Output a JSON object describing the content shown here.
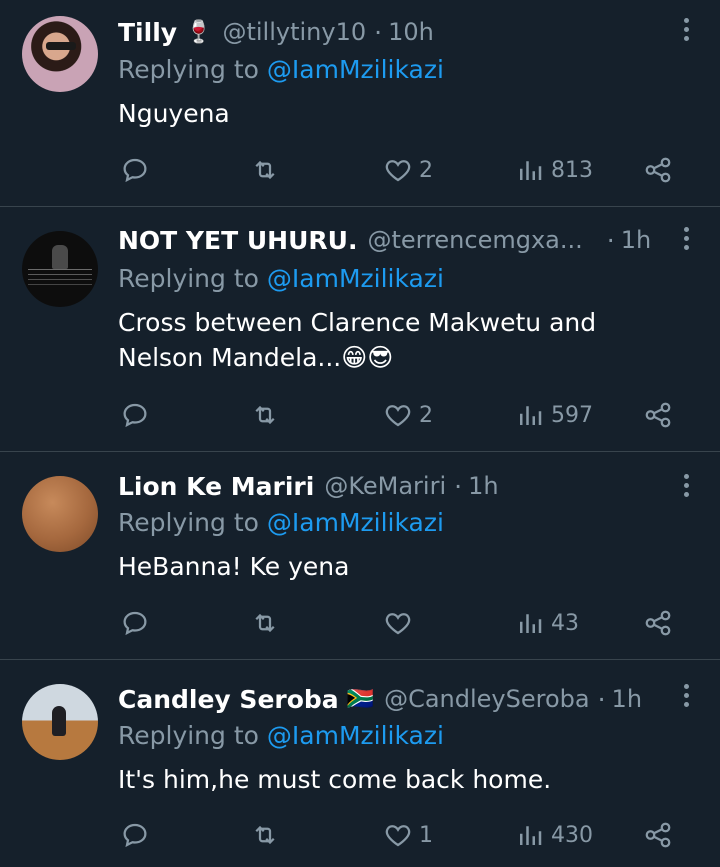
{
  "tweets": [
    {
      "name": "Tilly",
      "name_emoji": "🍷",
      "handle": "@tillytiny10",
      "separator": "·",
      "time": "10h",
      "replying_prefix": "Replying to",
      "replying_to": "@IamMzilikazi",
      "text": "Nguyena",
      "likes": "2",
      "views": "813"
    },
    {
      "name": "NOT YET UHURU.",
      "handle": "@terrencemgxa...",
      "separator": "·",
      "time": "1h",
      "replying_prefix": "Replying to",
      "replying_to": "@IamMzilikazi",
      "text": "Cross between Clarence Makwetu and Nelson Mandela...😁😎",
      "likes": "2",
      "views": "597"
    },
    {
      "name": "Lion Ke Mariri",
      "handle": "@KeMariri",
      "separator": "·",
      "time": "1h",
      "replying_prefix": "Replying to",
      "replying_to": "@IamMzilikazi",
      "text": "HeBanna! Ke yena",
      "likes": "",
      "views": "43"
    },
    {
      "name": "Candley Seroba",
      "name_emoji": "🇿🇦",
      "handle": "@CandleySeroba",
      "separator": "·",
      "time": "1h",
      "replying_prefix": "Replying to",
      "replying_to": "@IamMzilikazi",
      "text": "It's him,he must come back home.",
      "likes": "1",
      "views": "430"
    }
  ],
  "icons": [
    "reply-icon",
    "retweet-icon",
    "like-icon",
    "views-icon",
    "share-icon",
    "more-icon"
  ],
  "colors": {
    "background": "#15202b",
    "muted": "#8899a6",
    "link": "#1d9bf0",
    "divider": "#38444d",
    "text": "#ffffff"
  }
}
